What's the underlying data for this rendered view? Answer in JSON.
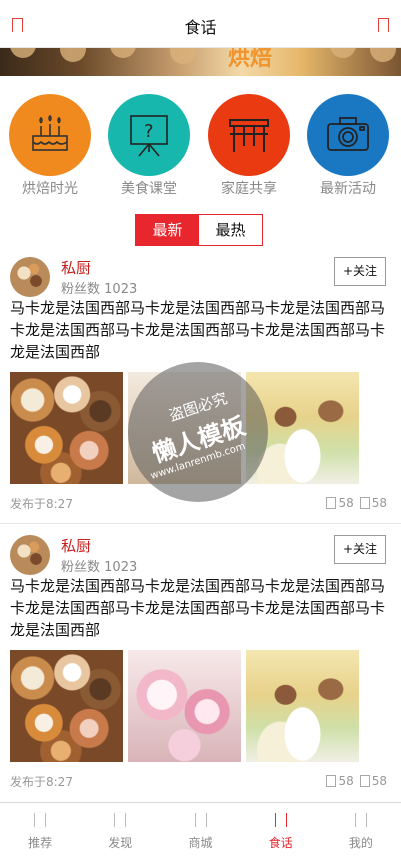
{
  "header": {
    "title": "食话"
  },
  "banner": {
    "text": "烘焙"
  },
  "categories": [
    {
      "label": "烘焙时光",
      "icon": "birthday-cake-icon",
      "color": "#f0891e"
    },
    {
      "label": "美食课堂",
      "icon": "classroom-board-icon",
      "color": "#18b7ae"
    },
    {
      "label": "家庭共享",
      "icon": "dining-table-icon",
      "color": "#e93a12"
    },
    {
      "label": "最新活动",
      "icon": "camera-icon",
      "color": "#1a78c2"
    }
  ],
  "toggle": {
    "latest": "最新",
    "hottest": "最热",
    "active": "最新",
    "accent": "#e8262e"
  },
  "posts": [
    {
      "username": "私厨",
      "fans_label": "粉丝数",
      "fans": "1023",
      "follow": "+关注",
      "text": "马卡龙是法国西部马卡龙是法国西部马卡龙是法国西部马卡龙是法国西部马卡龙是法国西部马卡龙是法国西部马卡龙是法国西部",
      "time": "发布于8:27",
      "stat1": "58",
      "stat2": "58"
    },
    {
      "username": "私厨",
      "fans_label": "粉丝数",
      "fans": "1023",
      "follow": "+关注",
      "text": "马卡龙是法国西部马卡龙是法国西部马卡龙是法国西部马卡龙是法国西部马卡龙是法国西部马卡龙是法国西部马卡龙是法国西部",
      "time": "发布于8:27",
      "stat1": "58",
      "stat2": "58"
    }
  ],
  "watermark": {
    "line1": "盗图必究",
    "line2": "懒人模板",
    "line3": "www.lanrenmb.com"
  },
  "tabbar": [
    {
      "label": "推荐"
    },
    {
      "label": "发现"
    },
    {
      "label": "商城"
    },
    {
      "label": "食话",
      "active": true
    },
    {
      "label": "我的"
    }
  ]
}
